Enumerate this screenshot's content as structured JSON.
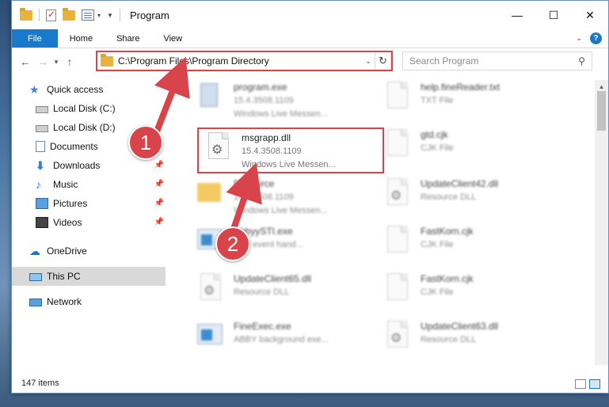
{
  "window": {
    "title": "Program",
    "controls": {
      "minimize": "—",
      "maximize": "☐",
      "close": "✕"
    }
  },
  "ribbon": {
    "tabs": [
      {
        "label": "File"
      },
      {
        "label": "Home"
      },
      {
        "label": "Share"
      },
      {
        "label": "View"
      }
    ]
  },
  "nav": {
    "address": "C:\\Program Files\\Program Directory",
    "search_placeholder": "Search Program"
  },
  "sidebar": {
    "items": [
      {
        "label": "Quick access",
        "icon": "star-icon"
      },
      {
        "label": "Local Disk (C:)",
        "icon": "disk-icon"
      },
      {
        "label": "Local Disk (D:)",
        "icon": "disk-icon"
      },
      {
        "label": "Documents",
        "icon": "documents-icon",
        "pinned": true
      },
      {
        "label": "Downloads",
        "icon": "downloads-icon",
        "pinned": true
      },
      {
        "label": "Music",
        "icon": "music-icon",
        "pinned": true
      },
      {
        "label": "Pictures",
        "icon": "pictures-icon",
        "pinned": true
      },
      {
        "label": "Videos",
        "icon": "videos-icon",
        "pinned": true
      },
      {
        "label": "OneDrive",
        "icon": "cloud-icon"
      },
      {
        "label": "This PC",
        "icon": "pc-icon",
        "selected": true
      },
      {
        "label": "Network",
        "icon": "network-icon"
      }
    ]
  },
  "files": [
    {
      "name": "program.exe",
      "line2": "15.4.3508.1109",
      "line3": "Windows Live Messen...",
      "kind": "setup"
    },
    {
      "name": "help.fineReader.txt",
      "line2": "TXT File",
      "kind": "doc"
    },
    {
      "name": "msgrapp.dll",
      "line2": "15.4.3508.1109",
      "line3": "Windows Live Messen...",
      "kind": "dll",
      "highlighted": true
    },
    {
      "name": "gtd.cjk",
      "line2": "CJK File",
      "kind": "doc"
    },
    {
      "name": "Resource",
      "line2": "15.4.3508.1109",
      "line3": "Windows Live Messen...",
      "kind": "folder"
    },
    {
      "name": "UpdateClient42.dll",
      "line2": "Resource DLL",
      "kind": "dll"
    },
    {
      "name": "AbbyySTI.exe",
      "line2": "Y sti event hand...",
      "kind": "exe"
    },
    {
      "name": "FastKorn.cjk",
      "line2": "CJK File",
      "kind": "doc"
    },
    {
      "name": "UpdateClient65.dll",
      "line2": "Resource DLL",
      "kind": "dll"
    },
    {
      "name": "FastKorn.cjk",
      "line2": "CJK File",
      "kind": "doc"
    },
    {
      "name": "FineExec.exe",
      "line2": "ABBY background exe...",
      "kind": "exe"
    },
    {
      "name": "UpdateClient63.dll",
      "line2": "Resource DLL",
      "kind": "dll"
    }
  ],
  "status": {
    "count": "147 items"
  },
  "annotations": {
    "step1": "1",
    "step2": "2",
    "color": "#d9434a"
  }
}
